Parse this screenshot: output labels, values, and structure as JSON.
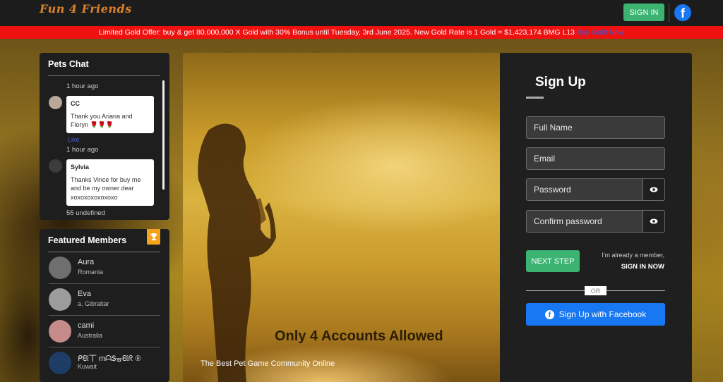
{
  "header": {
    "logo_text": "Fun 4 Friends",
    "signin_label": "SIGN IN",
    "facebook_glyph": "f"
  },
  "promo": {
    "text": "Limited Gold Offer: buy & get 80,000,000 X Gold with 30% Bonus until Tuesday, 3rd June 2025. New Gold Rate is 1 Gold = $1,423,174 BMG L13",
    "link_text": "Buy Gold Now",
    "color": "#ef1010"
  },
  "chat": {
    "title": "Pets Chat",
    "messages": [
      {
        "time": "1 hour ago",
        "name": "CC",
        "text": "Thank you Ariana and Floryn 🌹🌹🌹"
      },
      {
        "time": "1 hour ago",
        "name": "Sylvia",
        "text": "Thanks Vince for buy me and be my owner dear xoxoxoxoxoxoxo"
      }
    ],
    "like_label": "Like",
    "footer": "55 undefined"
  },
  "featured": {
    "title": "Featured Members",
    "icon": "trophy-icon",
    "members": [
      {
        "name": "Aura",
        "location": "Romania"
      },
      {
        "name": "Eva",
        "location": "a, Gibraltar"
      },
      {
        "name": "cami",
        "location": "Australia"
      },
      {
        "name": "ᑭᙓ丅 mᗩ$ᚗᙓᖇ ®",
        "location": "Kuwait"
      }
    ]
  },
  "hero": {
    "banner": "Only 4 Accounts Allowed",
    "subtitle": "The Best Pet Game Community Online"
  },
  "signup": {
    "title": "Sign Up",
    "fullname_placeholder": "Full Name",
    "email_placeholder": "Email",
    "password_placeholder": "Password",
    "confirm_placeholder": "Confirm password",
    "next_label": "NEXT STEP",
    "member_question": "I'm already a member,",
    "member_signin": "SIGN IN NOW",
    "or_label": "OR",
    "facebook_label": "Sign Up with Facebook"
  },
  "colors": {
    "accent_green": "#3cb371",
    "facebook_blue": "#1877f2",
    "panel_bg": "#1e1e1e"
  }
}
